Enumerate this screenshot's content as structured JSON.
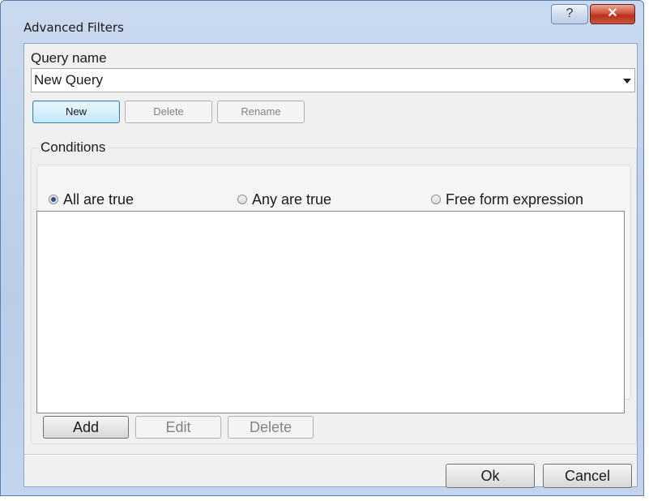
{
  "window": {
    "title": "Advanced Filters",
    "help_glyph": "?",
    "close_glyph": "✕"
  },
  "query": {
    "label": "Query name",
    "selected": "New Query"
  },
  "query_buttons": {
    "new": "New",
    "delete": "Delete",
    "rename": "Rename"
  },
  "conditions": {
    "legend": "Conditions",
    "modes": [
      {
        "label": "All are true",
        "checked": true
      },
      {
        "label": "Any are true",
        "checked": false
      },
      {
        "label": "Free form expression",
        "checked": false
      }
    ],
    "add": "Add",
    "edit": "Edit",
    "delete": "Delete"
  },
  "footer": {
    "ok": "Ok",
    "cancel": "Cancel"
  }
}
